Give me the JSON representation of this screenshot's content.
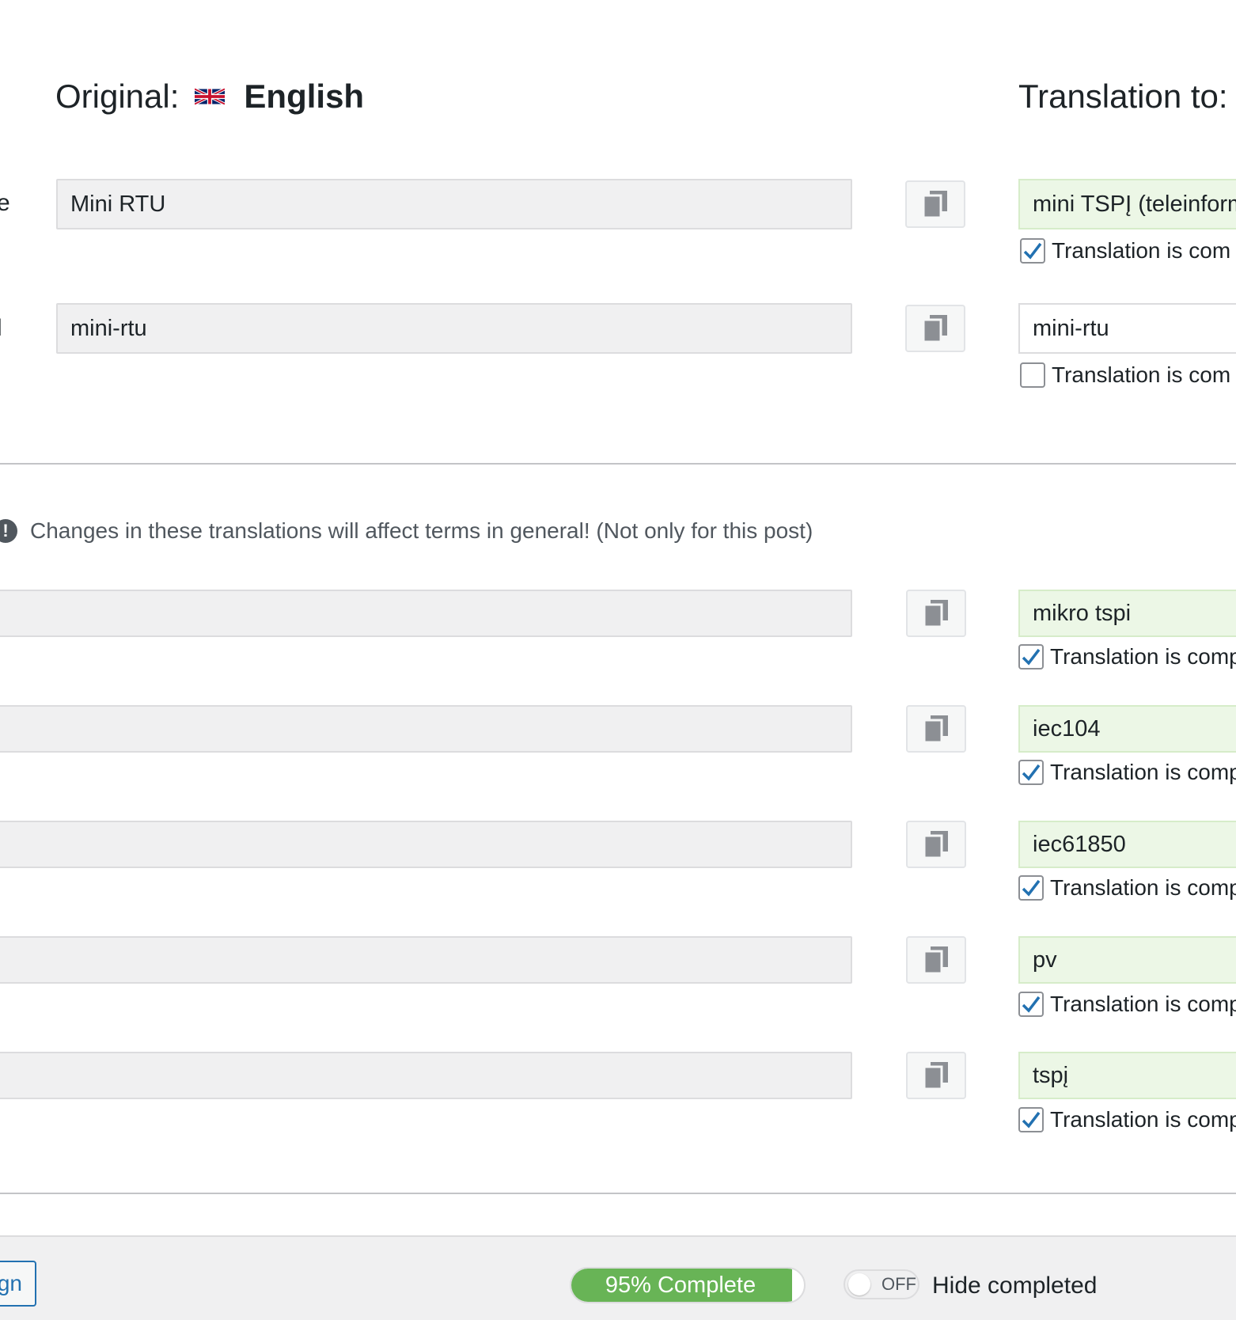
{
  "header": {
    "original_label": "Original:",
    "original_language": "English",
    "translation_label": "Translation to:"
  },
  "fields": [
    {
      "edge_label": "e",
      "original": "Mini RTU",
      "translation": "mini TSPĮ (teleinform",
      "complete_label": "Translation is com",
      "complete": true
    },
    {
      "edge_label": "l",
      "original": "mini-rtu",
      "translation": "mini-rtu",
      "complete_label": "Translation is com",
      "complete": false
    }
  ],
  "notice": {
    "icon": "!",
    "text": "Changes in these translations will affect terms in general! (Not only for this post)"
  },
  "terms": [
    {
      "original": "",
      "translation": "mikro tspi",
      "complete_label": "Translation is comp",
      "complete": true
    },
    {
      "original": "",
      "translation": "iec104",
      "complete_label": "Translation is comp",
      "complete": true
    },
    {
      "original": "",
      "translation": "iec61850",
      "complete_label": "Translation is comp",
      "complete": true
    },
    {
      "original": "",
      "translation": "pv",
      "complete_label": "Translation is comp",
      "complete": true
    },
    {
      "original": "",
      "translation": "tspį",
      "complete_label": "Translation is comp",
      "complete": true
    }
  ],
  "footer": {
    "button_label": "gn",
    "progress_percent": 95,
    "progress_label": "95% Complete",
    "toggle_state": "OFF",
    "hide_completed_label": "Hide completed"
  },
  "colors": {
    "completed_field_bg": "#ecf7e6",
    "progress_fill": "#68b456",
    "checkmark": "#2271b1"
  },
  "icons": {
    "copy": "copy-icon",
    "notice": "exclamation-circle-icon",
    "flag": "uk-flag-icon",
    "check": "checkmark-icon"
  }
}
